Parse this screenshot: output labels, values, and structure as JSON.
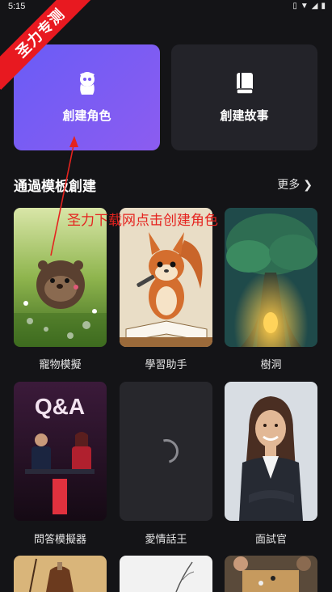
{
  "status_bar": {
    "time": "5:15",
    "icons": [
      "vibrate-icon",
      "wifi-icon",
      "signal-icon",
      "battery-icon"
    ]
  },
  "watermark": {
    "text": "圣力专测"
  },
  "actions": {
    "create_character": {
      "label": "創建角色",
      "icon": "character-icon"
    },
    "create_story": {
      "label": "創建故事",
      "icon": "book-icon"
    }
  },
  "templates_section": {
    "title": "通過模板創建",
    "more_label": "更多"
  },
  "annotation": {
    "text": "圣力下载网点击创建角色"
  },
  "templates": [
    {
      "label": "寵物模擬"
    },
    {
      "label": "學習助手"
    },
    {
      "label": "樹洞"
    },
    {
      "label": "問答模擬器",
      "image_text": "Q&A"
    },
    {
      "label": "愛情話王"
    },
    {
      "label": "面試官"
    }
  ],
  "colors": {
    "background": "#141417",
    "accent_purple": "#7a5cf5",
    "card_dark": "#232329",
    "annotation_red": "#e5231f"
  }
}
